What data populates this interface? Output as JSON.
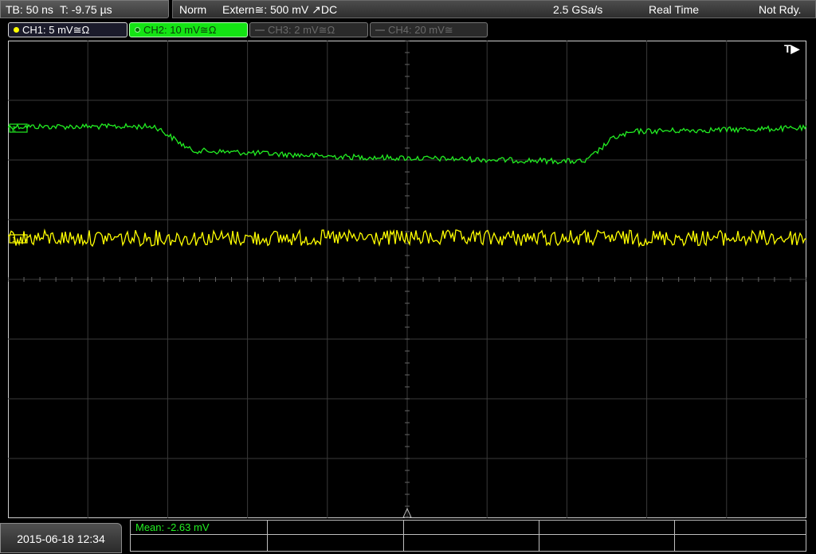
{
  "status": {
    "timebase": "TB: 50 ns",
    "trigger_time": "T: -9.75 µs",
    "trigger_mode": "Norm",
    "trigger_source": "Extern≅: 500 mV ↗DC",
    "sample_rate": "2.5 GSa/s",
    "acq_mode": "Real Time",
    "ready_state": "Not Rdy."
  },
  "channels": [
    {
      "label": "CH1: 5 mV≅Ω",
      "color": "#ffff00",
      "active": true
    },
    {
      "label": "CH2: 10 mV≅Ω",
      "color": "#22ee22",
      "active": true,
      "selected": true
    },
    {
      "label": "CH3: 2 mV≅Ω",
      "active": false
    },
    {
      "label": "CH4: 20 mV≅",
      "active": false
    }
  ],
  "trigger_marker": "T▶",
  "datetime": "2015-06-18 12:34",
  "measurement": {
    "mean": "Mean: -2.63 mV"
  },
  "colors": {
    "ch1": "#ffff00",
    "ch2": "#22ee22",
    "grid": "#3a3a3a"
  }
}
